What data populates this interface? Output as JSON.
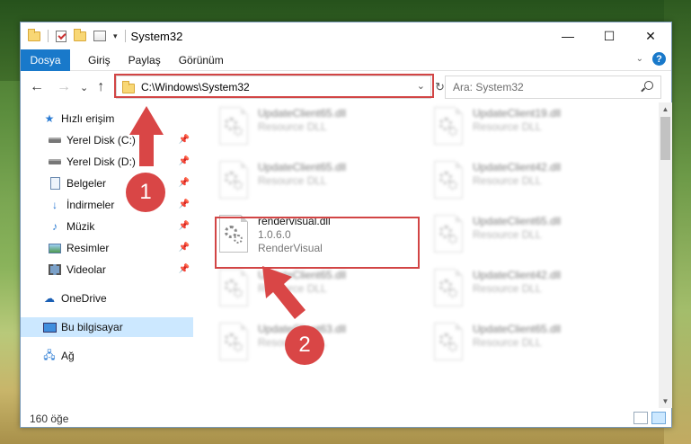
{
  "window": {
    "title": "System32",
    "controls": {
      "minimize": "—",
      "maximize": "☐",
      "close": "✕"
    }
  },
  "ribbon": {
    "tabs": [
      "Dosya",
      "Giriş",
      "Paylaş",
      "Görünüm"
    ],
    "expand_icon": "chevron-down-icon",
    "help_label": "?"
  },
  "navigation": {
    "back": "←",
    "forward": "→",
    "recent": "⌄",
    "up": "↑",
    "address": "C:\\Windows\\System32",
    "search_placeholder": "Ara: System32"
  },
  "sidebar": {
    "items": [
      {
        "label": "Hızlı erişim",
        "icon": "star-icon",
        "pinned": false
      },
      {
        "label": "Yerel Disk (C:)",
        "icon": "drive-icon",
        "pinned": true
      },
      {
        "label": "Yerel Disk (D:)",
        "icon": "drive-icon",
        "pinned": true
      },
      {
        "label": "Belgeler",
        "icon": "documents-icon",
        "pinned": true
      },
      {
        "label": "İndirmeler",
        "icon": "download-icon",
        "pinned": true
      },
      {
        "label": "Müzik",
        "icon": "music-icon",
        "pinned": true
      },
      {
        "label": "Resimler",
        "icon": "pictures-icon",
        "pinned": true
      },
      {
        "label": "Videolar",
        "icon": "videos-icon",
        "pinned": true
      },
      {
        "label": "OneDrive",
        "icon": "cloud-icon",
        "pinned": false
      },
      {
        "label": "Bu bilgisayar",
        "icon": "computer-icon",
        "pinned": false,
        "selected": true
      },
      {
        "label": "Ağ",
        "icon": "network-icon",
        "pinned": false
      }
    ]
  },
  "files": {
    "left": [
      {
        "name": "UpdateClient65.dll",
        "sub": "Resource DLL"
      },
      {
        "name": "UpdateClient65.dll",
        "sub": "Resource DLL"
      },
      {
        "name": "rendervisual.dll",
        "version": "1.0.6.0",
        "sub": "RenderVisual",
        "highlighted": true
      },
      {
        "name": "UpdateClient65.dll",
        "sub": "Resource DLL"
      },
      {
        "name": "UpdateClient63.dll",
        "sub": "Resource DLL"
      }
    ],
    "right": [
      {
        "name": "UpdateClient19.dll",
        "sub": "Resource DLL"
      },
      {
        "name": "UpdateClient42.dll",
        "sub": "Resource DLL"
      },
      {
        "name": "UpdateClient65.dll",
        "sub": "Resource DLL"
      },
      {
        "name": "UpdateClient42.dll",
        "sub": "Resource DLL"
      },
      {
        "name": "UpdateClient65.dll",
        "sub": "Resource DLL"
      }
    ]
  },
  "status": {
    "count": "160 öğe"
  },
  "markers": [
    "1",
    "2"
  ],
  "colors": {
    "accent": "#1979ca",
    "highlight": "#d24545",
    "selection": "#cce8ff"
  }
}
